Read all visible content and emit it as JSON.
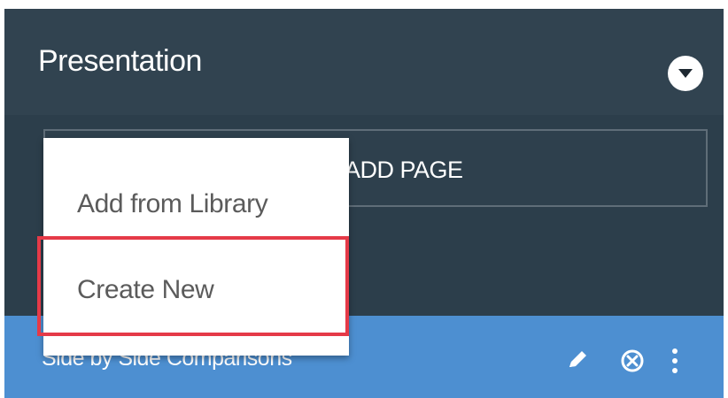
{
  "panel": {
    "title": "Presentation",
    "toggle_icon": "chevron-down-circle-icon",
    "add_page_label": "ADD PAGE"
  },
  "menu": {
    "items": [
      {
        "label": "Add from Library"
      },
      {
        "label": "Create New"
      }
    ]
  },
  "row": {
    "title": "Side by Side Comparisons",
    "actions": [
      {
        "icon": "pencil-icon"
      },
      {
        "icon": "remove-circle-icon"
      },
      {
        "icon": "more-vertical-icon"
      }
    ]
  },
  "colors": {
    "panel_background": "#2c3e4b",
    "header_background": "#314350",
    "selected_row": "#4d8fd1",
    "menu_background": "#ffffff",
    "menu_text": "#5b5b5b",
    "highlight": "#e53a48"
  }
}
